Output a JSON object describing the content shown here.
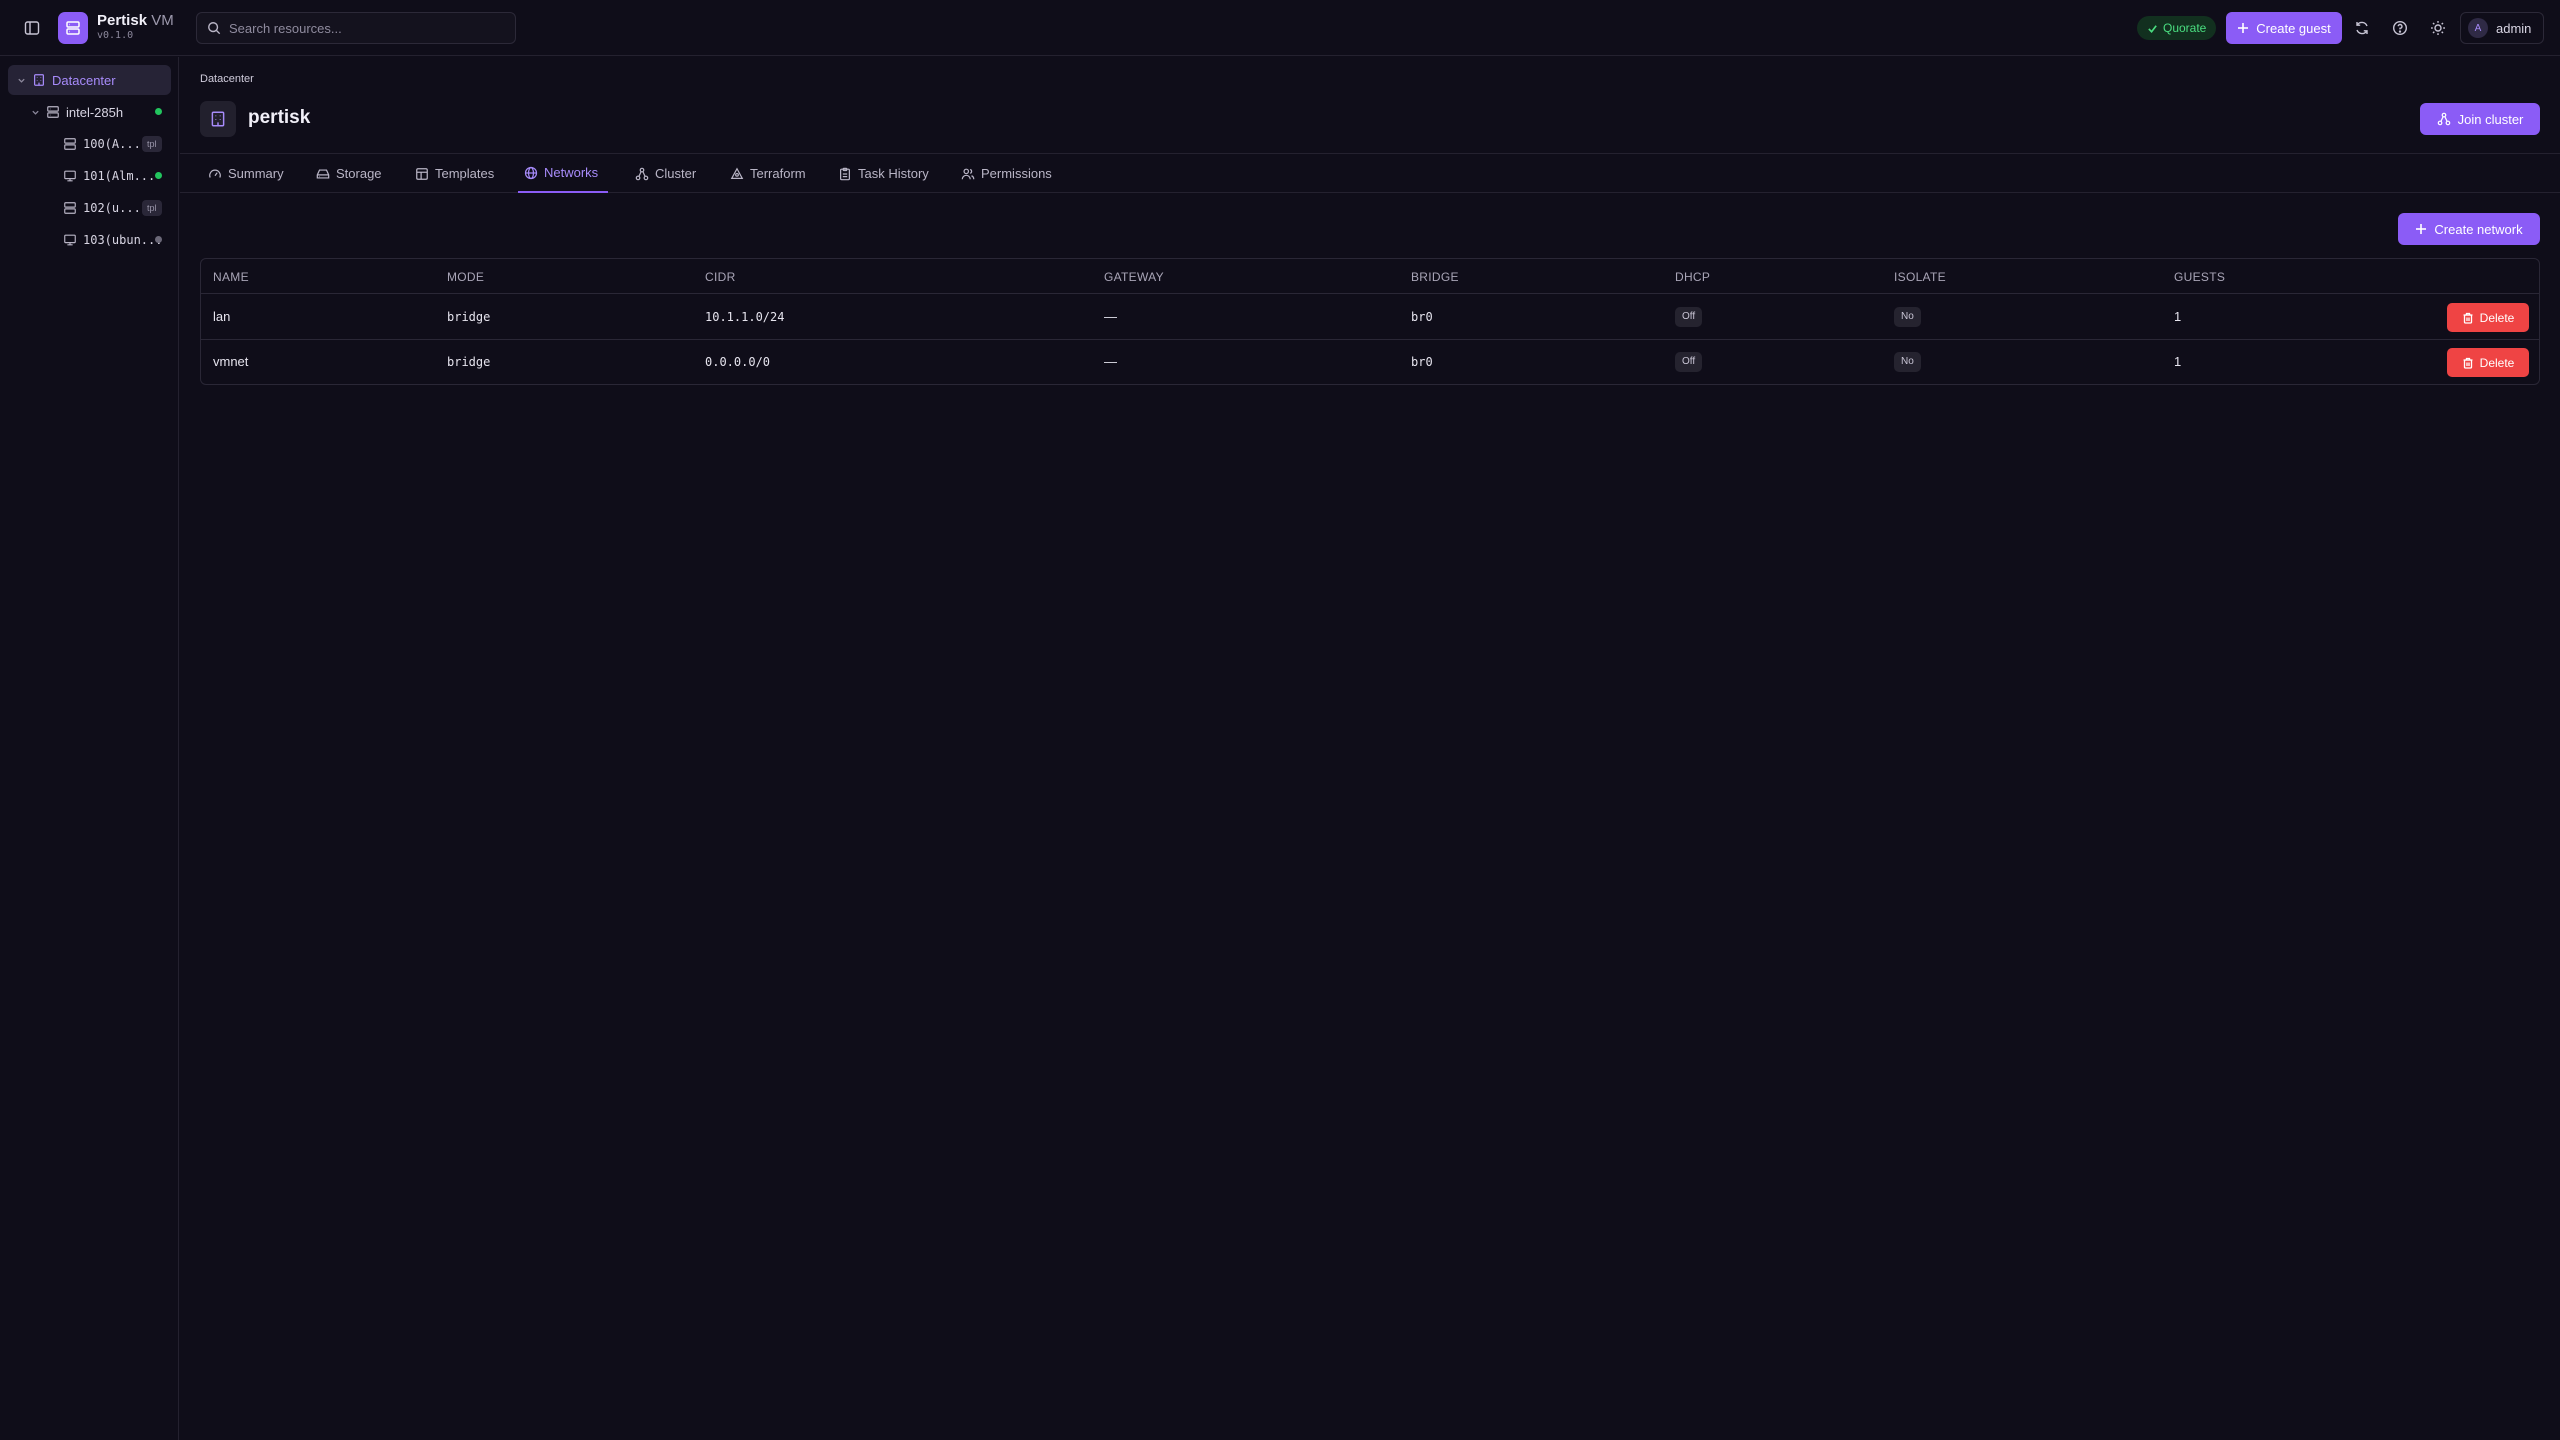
{
  "app": {
    "name": "Pertisk",
    "name_suffix": "VM",
    "version": "v0.1.0"
  },
  "topbar": {
    "search_placeholder": "Search resources...",
    "quorate_label": "Quorate",
    "create_guest_label": "Create guest",
    "user_initial": "A",
    "user_name": "admin"
  },
  "sidebar": {
    "datacenter_label": "Datacenter",
    "node_label": "intel-285h",
    "guests": [
      {
        "label": "100(A...",
        "tag": "tpl",
        "icon": "template-icon"
      },
      {
        "label": "101(Alm...",
        "status": "running",
        "icon": "vm-icon"
      },
      {
        "label": "102(u...",
        "tag": "tpl",
        "icon": "template-icon"
      },
      {
        "label": "103(ubun...",
        "status": "stopped",
        "icon": "vm-icon"
      }
    ]
  },
  "main": {
    "breadcrumb": "Datacenter",
    "title": "pertisk",
    "join_cluster_label": "Join cluster",
    "create_network_label": "Create network",
    "tabs": [
      {
        "label": "Summary",
        "icon": "gauge-icon"
      },
      {
        "label": "Storage",
        "icon": "hard-drive-icon"
      },
      {
        "label": "Templates",
        "icon": "template-icon"
      },
      {
        "label": "Networks",
        "icon": "globe-icon",
        "active": true
      },
      {
        "label": "Cluster",
        "icon": "cluster-icon"
      },
      {
        "label": "Terraform",
        "icon": "terraform-icon"
      },
      {
        "label": "Task History",
        "icon": "clipboard-icon"
      },
      {
        "label": "Permissions",
        "icon": "users-icon"
      }
    ]
  },
  "table": {
    "columns": [
      "NAME",
      "MODE",
      "CIDR",
      "GATEWAY",
      "BRIDGE",
      "DHCP",
      "ISOLATE",
      "GUESTS"
    ],
    "rows": [
      {
        "name": "lan",
        "mode": "bridge",
        "cidr": "10.1.1.0/24",
        "gateway": "—",
        "bridge": "br0",
        "dhcp": "Off",
        "isolate": "No",
        "guests": "1"
      },
      {
        "name": "vmnet",
        "mode": "bridge",
        "cidr": "0.0.0.0/0",
        "gateway": "—",
        "bridge": "br0",
        "dhcp": "Off",
        "isolate": "No",
        "guests": "1"
      }
    ],
    "delete_label": "Delete"
  },
  "colors": {
    "accent": "#8b5cf6",
    "accent_text": "#a78bfa",
    "danger": "#ef4444",
    "success": "#4ade80",
    "background": "#0f0d19"
  }
}
